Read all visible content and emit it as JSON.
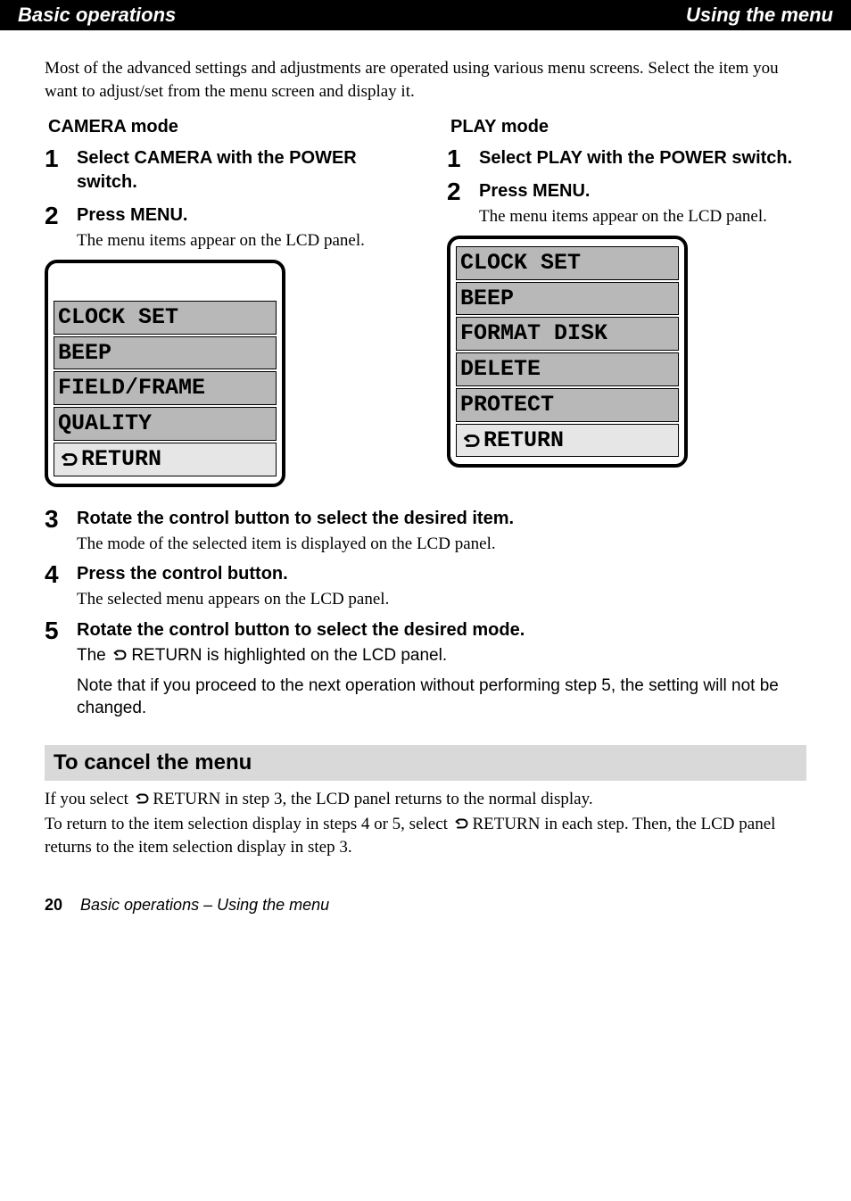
{
  "header": {
    "left": "Basic operations",
    "right": "Using the menu"
  },
  "intro": "Most of the advanced settings and adjustments are operated using various menu screens. Select the item you want to adjust/set from the menu screen and display it.",
  "col_left": {
    "title": "CAMERA mode",
    "step1_title": "Select CAMERA with the POWER switch.",
    "step2_title": "Press MENU.",
    "step2_body": "The menu items appear on the LCD panel.",
    "menu": [
      "CLOCK SET",
      "BEEP",
      "FIELD/FRAME",
      "QUALITY",
      "RETURN"
    ]
  },
  "col_right": {
    "title": "PLAY mode",
    "step1_title": "Select PLAY with the POWER switch.",
    "step2_title": "Press MENU.",
    "step2_body": "The menu items appear on the LCD panel.",
    "menu": [
      "CLOCK SET",
      "BEEP",
      "FORMAT DISK",
      "DELETE",
      "PROTECT",
      "RETURN"
    ]
  },
  "step3": {
    "title": "Rotate the control button to select the desired item.",
    "body": "The mode of the selected item is displayed on the LCD panel."
  },
  "step4": {
    "title": "Press the control button.",
    "body": "The selected menu appears on the LCD panel."
  },
  "step5": {
    "title": "Rotate the control button to select the desired mode.",
    "body_prefix": "The ",
    "body_suffix": "RETURN is highlighted on the LCD panel."
  },
  "note": "Note that if you proceed to the next operation without performing step 5, the setting will not be changed.",
  "cancel": {
    "heading": "To cancel the menu",
    "p1_prefix": "If you select ",
    "p1_mid": "RETURN in step 3, the LCD panel returns to the normal display.",
    "p2_prefix": "To return to the item selection display in steps 4 or 5, select ",
    "p2_suffix": "RETURN in each step. Then, the LCD panel returns to the item selection display in step 3."
  },
  "footer": {
    "page": "20",
    "label": "Basic operations – Using the menu"
  }
}
